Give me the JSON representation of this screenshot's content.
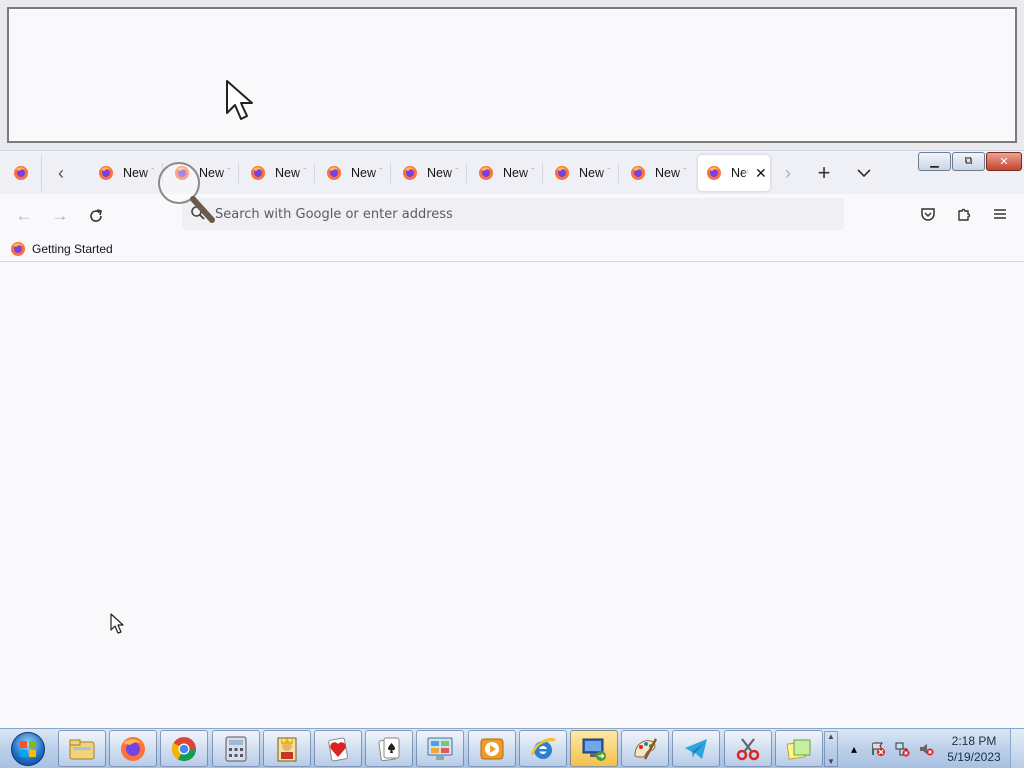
{
  "browser": {
    "tabs": [
      {
        "label": "New Tab",
        "active": false
      },
      {
        "label": "New Tab",
        "active": false
      },
      {
        "label": "New Tab",
        "active": false
      },
      {
        "label": "New Tab",
        "active": false
      },
      {
        "label": "New Tab",
        "active": false
      },
      {
        "label": "New Tab",
        "active": false
      },
      {
        "label": "New Tab",
        "active": false
      },
      {
        "label": "New Tab",
        "active": false
      },
      {
        "label": "New Tab",
        "active": true
      }
    ],
    "urlbar": {
      "placeholder": "Search with Google or enter address",
      "value": ""
    },
    "bookmarks": [
      {
        "label": "Getting Started"
      }
    ]
  },
  "taskbar": {
    "apps": [
      {
        "name": "windows-explorer"
      },
      {
        "name": "firefox"
      },
      {
        "name": "chrome"
      },
      {
        "name": "calculator"
      },
      {
        "name": "freecell"
      },
      {
        "name": "hearts"
      },
      {
        "name": "solitaire"
      },
      {
        "name": "control-panel"
      },
      {
        "name": "media-player"
      },
      {
        "name": "internet-explorer"
      },
      {
        "name": "remote-desktop",
        "active": true
      },
      {
        "name": "paint"
      },
      {
        "name": "telegram"
      },
      {
        "name": "snipping-tool"
      },
      {
        "name": "sticky-notes"
      }
    ],
    "clock": {
      "time": "2:18 PM",
      "date": "5/19/2023"
    }
  },
  "colors": {
    "firefox_accent": "#ff7139",
    "taskbar_blue": "#bcd0ea",
    "close_red": "#c5452c"
  }
}
